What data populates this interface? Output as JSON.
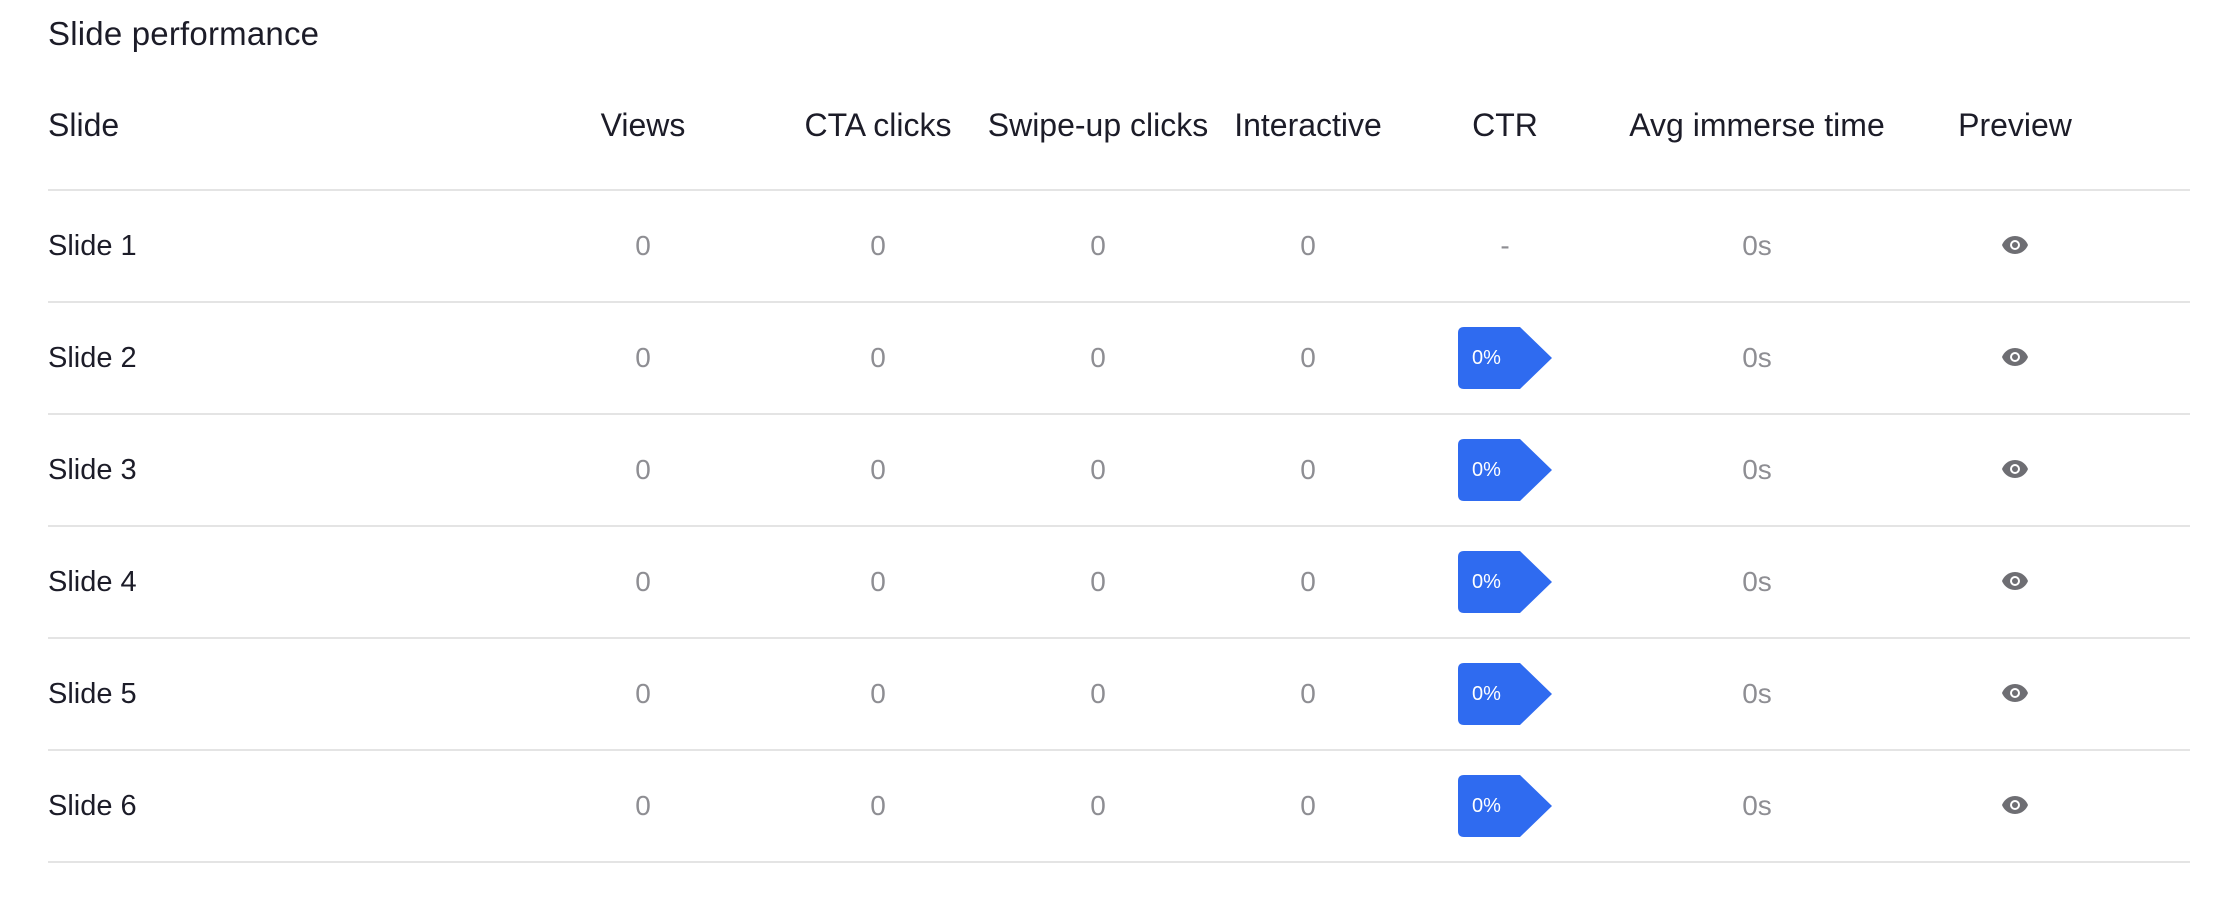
{
  "section": {
    "title": "Slide performance"
  },
  "table": {
    "headers": {
      "slide": "Slide",
      "views": "Views",
      "cta_clicks": "CTA clicks",
      "swipe_up_clicks": "Swipe-up clicks",
      "interactive": "Interactive",
      "ctr": "CTR",
      "avg_immerse_time": "Avg immerse time",
      "preview": "Preview"
    },
    "rows": [
      {
        "slide": "Slide 1",
        "views": "0",
        "cta_clicks": "0",
        "swipe_up_clicks": "0",
        "interactive": "0",
        "ctr": "-",
        "avg_immerse_time": "0s"
      },
      {
        "slide": "Slide 2",
        "views": "0",
        "cta_clicks": "0",
        "swipe_up_clicks": "0",
        "interactive": "0",
        "ctr": "0%",
        "avg_immerse_time": "0s"
      },
      {
        "slide": "Slide 3",
        "views": "0",
        "cta_clicks": "0",
        "swipe_up_clicks": "0",
        "interactive": "0",
        "ctr": "0%",
        "avg_immerse_time": "0s"
      },
      {
        "slide": "Slide 4",
        "views": "0",
        "cta_clicks": "0",
        "swipe_up_clicks": "0",
        "interactive": "0",
        "ctr": "0%",
        "avg_immerse_time": "0s"
      },
      {
        "slide": "Slide 5",
        "views": "0",
        "cta_clicks": "0",
        "swipe_up_clicks": "0",
        "interactive": "0",
        "ctr": "0%",
        "avg_immerse_time": "0s"
      },
      {
        "slide": "Slide 6",
        "views": "0",
        "cta_clicks": "0",
        "swipe_up_clicks": "0",
        "interactive": "0",
        "ctr": "0%",
        "avg_immerse_time": "0s"
      }
    ]
  },
  "icons": {
    "preview": "eye-icon"
  },
  "colors": {
    "ctr_badge": "#2f6bf0",
    "text_primary": "#1c1c28",
    "text_muted": "#8e8e93",
    "divider": "#e4e4e4",
    "icon": "#6e6e73"
  }
}
